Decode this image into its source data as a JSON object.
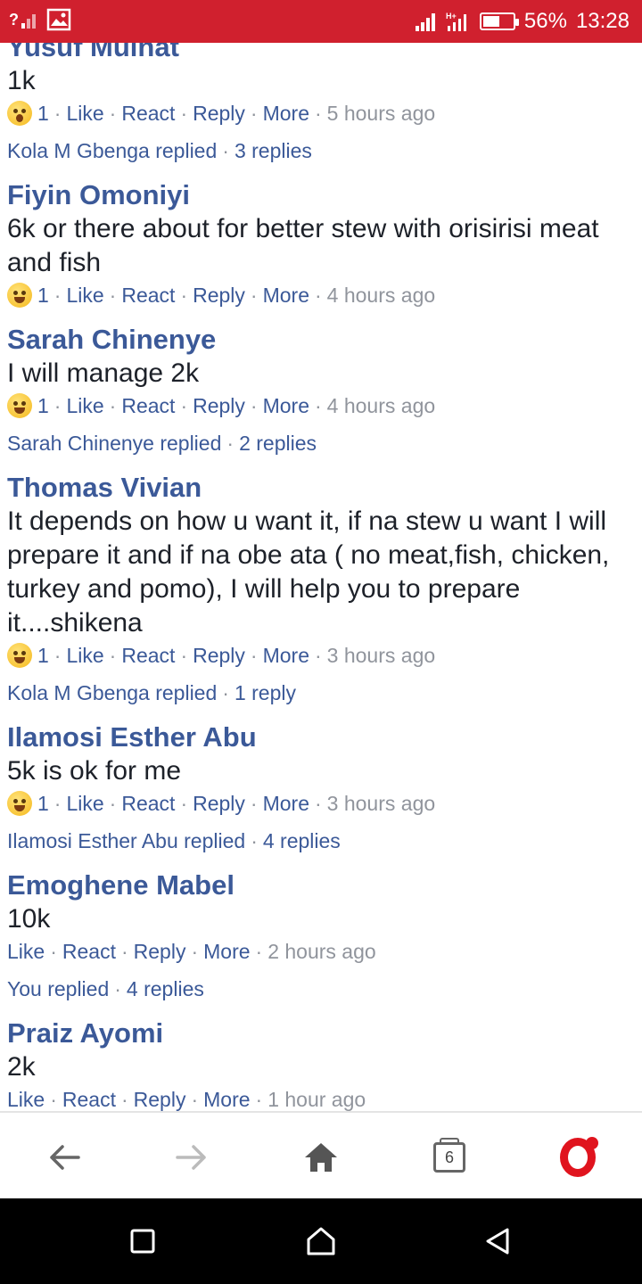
{
  "status_bar": {
    "battery_percent": "56%",
    "time": "13:28",
    "battery_level": 0.56,
    "icons": [
      "unknown-signal-icon",
      "image-icon",
      "signal-icon",
      "data-signal-icon",
      "battery-icon"
    ]
  },
  "comments": [
    {
      "author": "Yusuf Muinat",
      "text": "1k",
      "reaction_icon": "wow-emoji-icon",
      "reaction_count": "1",
      "like": "Like",
      "react": "React",
      "reply": "Reply",
      "more": "More",
      "time": "5 hours ago",
      "replies_by": "Kola M Gbenga replied",
      "replies_count": "3 replies"
    },
    {
      "author": "Fiyin Omoniyi",
      "text": "6k or there about for better stew with orisirisi meat and fish",
      "reaction_icon": "haha-emoji-icon",
      "reaction_count": "1",
      "like": "Like",
      "react": "React",
      "reply": "Reply",
      "more": "More",
      "time": "4 hours ago"
    },
    {
      "author": "Sarah Chinenye",
      "text": "I will manage 2k",
      "reaction_icon": "haha-emoji-icon",
      "reaction_count": "1",
      "like": "Like",
      "react": "React",
      "reply": "Reply",
      "more": "More",
      "time": "4 hours ago",
      "replies_by": "Sarah Chinenye replied",
      "replies_count": "2 replies"
    },
    {
      "author": "Thomas Vivian",
      "text": "It depends on how u want it, if na stew u want I will prepare it and if na obe ata ( no meat,fish, chicken, turkey and pomo), I will help you to prepare it....shikena",
      "reaction_icon": "haha-emoji-icon",
      "reaction_count": "1",
      "like": "Like",
      "react": "React",
      "reply": "Reply",
      "more": "More",
      "time": "3 hours ago",
      "replies_by": "Kola M Gbenga replied",
      "replies_count": "1 reply"
    },
    {
      "author": "Ilamosi Esther Abu",
      "text": "5k is ok for me",
      "reaction_icon": "haha-emoji-icon",
      "reaction_count": "1",
      "like": "Like",
      "react": "React",
      "reply": "Reply",
      "more": "More",
      "time": "3 hours ago",
      "replies_by": "Ilamosi Esther Abu replied",
      "replies_count": "4 replies"
    },
    {
      "author": "Emoghene Mabel",
      "text": "10k",
      "like": "Like",
      "react": "React",
      "reply": "Reply",
      "more": "More",
      "time": "2 hours ago",
      "replies_by": "You replied",
      "replies_count": "4 replies"
    },
    {
      "author": "Praiz Ayomi",
      "text": "2k",
      "like": "Like",
      "react": "React",
      "reply": "Reply",
      "more": "More",
      "time": "1 hour ago"
    }
  ],
  "toolbar": {
    "tab_count": "6",
    "icons": [
      "back-arrow-icon",
      "forward-arrow-icon",
      "home-icon",
      "tabs-icon",
      "opera-menu-icon"
    ]
  },
  "navbar": {
    "icons": [
      "recents-square-icon",
      "home-circle-icon",
      "back-triangle-icon"
    ]
  },
  "colors": {
    "status_bar": "#d0202e",
    "author_link": "#3b5998",
    "meta_gray": "#90949c",
    "opera_red": "#e0141e"
  }
}
